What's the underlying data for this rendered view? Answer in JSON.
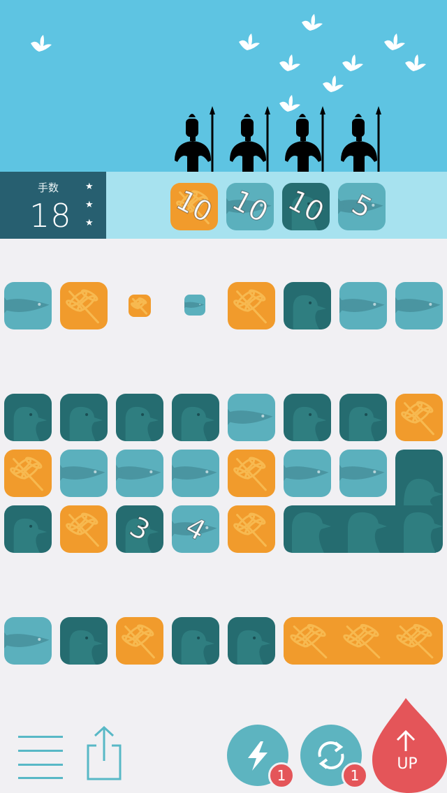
{
  "colors": {
    "sky": "#5ec4e2",
    "ground": "#a7e2ef",
    "board_bg": "#f1f0f3",
    "panel": "#275f70",
    "light_teal": "#5bb0bd",
    "dark_teal": "#256c70",
    "orange": "#f19b2c",
    "accent_red": "#e45559",
    "button_teal": "#5db4c0"
  },
  "moves": {
    "label": "手数",
    "count": "18",
    "stars": [
      "★",
      "★",
      "★"
    ]
  },
  "targets": [
    {
      "type": "dragonfly",
      "color": "orange",
      "remaining": "10"
    },
    {
      "type": "fish",
      "color": "light_teal",
      "remaining": "10"
    },
    {
      "type": "bird",
      "color": "dark_teal",
      "remaining": "10"
    },
    {
      "type": "fish",
      "color": "light_teal",
      "remaining": "5"
    }
  ],
  "board": {
    "rows": [
      [
        "fish",
        "dragonfly",
        "dragonfly-small",
        "fish-small",
        "dragonfly",
        "bird",
        "fish",
        "fish"
      ],
      [
        "bird",
        "bird",
        "bird",
        "bird",
        "fish",
        "bird",
        "bird",
        "dragonfly"
      ],
      [
        "dragonfly",
        "fish",
        "fish",
        "fish",
        "dragonfly",
        "fish",
        "fish",
        "bird"
      ],
      [
        "bird",
        "dragonfly",
        "bird-3",
        "fish-4",
        "dragonfly",
        "bird",
        "bird",
        "bird"
      ],
      [
        "fish",
        "bird",
        "dragonfly",
        "bird",
        "bird",
        "dragonfly",
        "dragonfly",
        "dragonfly"
      ]
    ],
    "numbered_tiles": {
      "bird_value": "3",
      "fish_value": "4"
    }
  },
  "toolbar": {
    "menu_icon": "menu-icon",
    "share_icon": "share-icon",
    "lightning_badge": "1",
    "shuffle_badge": "1",
    "up_label": "UP"
  }
}
